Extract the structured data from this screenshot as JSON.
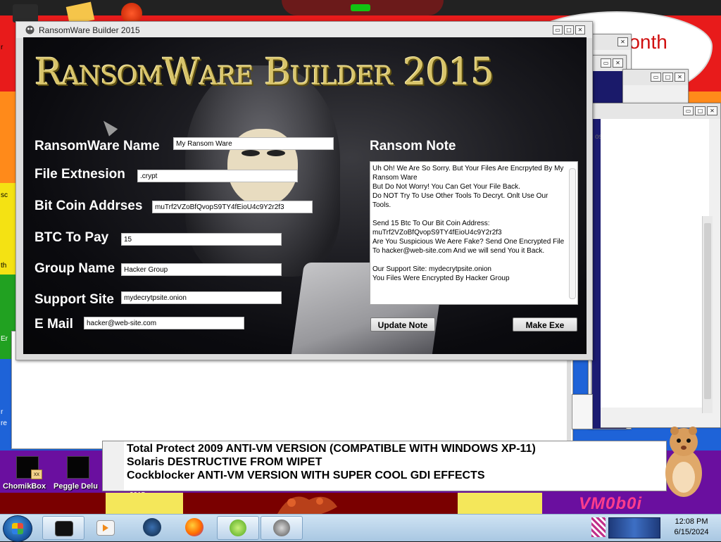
{
  "desktop": {
    "bubble_text": "month",
    "watermark": "VM0b0i",
    "icons": [
      {
        "label": "ChomikBox"
      },
      {
        "label": "Peggle Delu"
      }
    ],
    "icon_tag": "xx",
    "sub_label": "2015",
    "left_strip": [
      "r",
      "sc",
      "th",
      "Er",
      "r",
      "re"
    ],
    "colors": {
      "red": "#e81b1b",
      "orange": "#ff8a1a",
      "yellow": "#f4e213",
      "green": "#21a121",
      "blue": "#1e63d8",
      "purple": "#6a0f9f"
    }
  },
  "background_windows": {
    "text_window_lines": [
      "Total Protect 2009 ANTI-VM VERSION (COMPATIBLE WITH WINDOWS XP-11)",
      "Solaris DESTRUCTIVE FROM WIPET",
      "Cockblocker ANTI-VM VERSION WITH SUPER COOL GDI EFFECTS"
    ],
    "partial_text": "os"
  },
  "app": {
    "window_title": "RansomWare Builder 2015",
    "banner_title": "RansomWare Builder 2015",
    "labels": {
      "name": "RansomWare Name",
      "extension": "File Extnesion",
      "btc_address": "Bit Coin Addrses",
      "btc_amount": "BTC To Pay",
      "group": "Group Name",
      "site": "Support Site",
      "email": "E Mail",
      "note": "Ransom Note"
    },
    "fields": {
      "name": "My Ransom Ware",
      "extension": ".crypt",
      "btc_address": "muTrf2VZoBfQvopS9TY4fEioU4c9Y2r2f3",
      "btc_amount": "15",
      "group": "Hacker Group",
      "site": "mydecrytpsite.onion",
      "email": "hacker@web-site.com"
    },
    "note_text": "Uh Oh! We Are So Sorry. But Your Files Are Encrpyted By My Ransom Ware\nBut Do Not Worry! You Can Get Your File Back.\nDo NOT Try To Use Other Tools To Decryt. Onlt Use Our Tools.\n\nSend 15 Btc To Our Bit Coin Address:\nmuTrf2VZoBfQvopS9TY4fEioU4c9Y2r2f3\nAre You Suspicious We Aere Fake? Send One Encrypted File To hacker@web-site.com And we will send You it Back.\n\nOur Support Site: mydecrytpsite.onion\nYou Files Were Encrypted By Hacker Group",
    "buttons": {
      "update": "Update Note",
      "make": "Make Exe"
    },
    "banner_color": "#d8c46a"
  },
  "window_controls": {
    "minimize": "▭",
    "maximize": "□",
    "close": "✕"
  },
  "taskbar": {
    "time": "12:08 PM",
    "date": "6/15/2024",
    "items": [
      "terminal-icon",
      "media-player-icon",
      "globe-icon",
      "firefox-icon",
      "spinner-app-icon",
      "skull-app-icon"
    ]
  }
}
